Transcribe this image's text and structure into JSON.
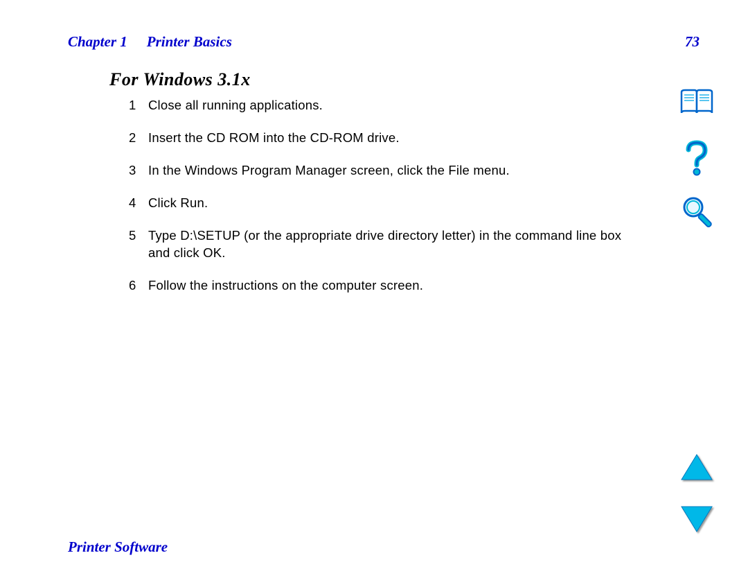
{
  "header": {
    "chapter": "Chapter 1",
    "title": "Printer Basics",
    "page": "73"
  },
  "section": {
    "heading": "For Windows 3.1x"
  },
  "steps": [
    {
      "n": "1",
      "text": "Close all running applications."
    },
    {
      "n": "2",
      "text": "Insert the CD ROM into the CD-ROM drive."
    },
    {
      "n": "3",
      "text": "In the Windows Program Manager   screen, click the File menu."
    },
    {
      "n": "4",
      "text": "Click Run."
    },
    {
      "n": "5",
      "text": "Type D:\\SETUP (or the appropriate drive directory letter) in the command line box and click OK."
    },
    {
      "n": "6",
      "text": "Follow the instructions on the computer screen."
    }
  ],
  "footer": {
    "section": "Printer Software"
  },
  "icons": {
    "book": "book-icon",
    "help": "help-icon",
    "search": "search-icon",
    "up": "page-up-icon",
    "down": "page-down-icon"
  },
  "colors": {
    "accent": "#00a8e8",
    "link": "#0000cc"
  }
}
